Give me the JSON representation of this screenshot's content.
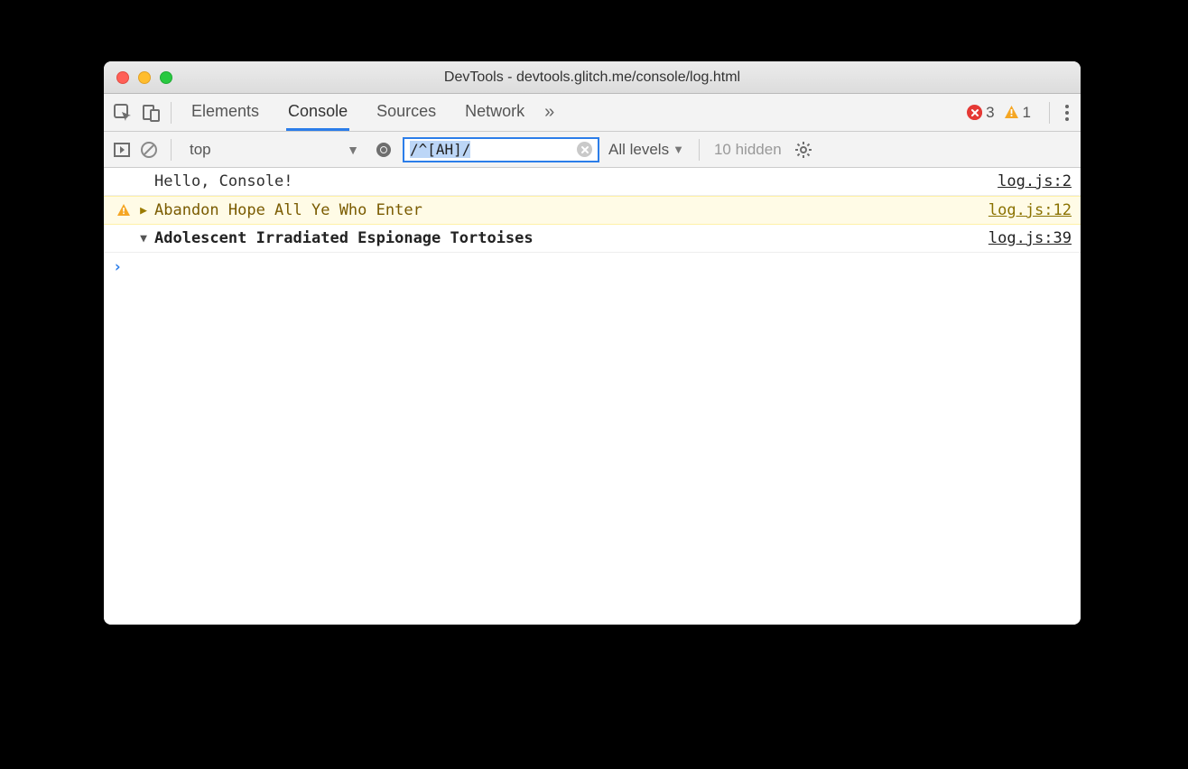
{
  "window": {
    "title": "DevTools - devtools.glitch.me/console/log.html"
  },
  "tabs": {
    "items": [
      "Elements",
      "Console",
      "Sources",
      "Network"
    ],
    "active_index": 1,
    "more_glyph": "»"
  },
  "status": {
    "error_count": "3",
    "warning_count": "1"
  },
  "toolbar": {
    "context": "top",
    "filter_value": "/^[AH]/",
    "levels_label": "All levels",
    "hidden_label": "10 hidden"
  },
  "logs": [
    {
      "type": "log",
      "disclosure": "",
      "message": "Hello, Console!",
      "source": "log.js:2"
    },
    {
      "type": "warn",
      "disclosure": "right",
      "message": "Abandon Hope All Ye Who Enter",
      "source": "log.js:12"
    },
    {
      "type": "info",
      "disclosure": "down",
      "message": "Adolescent Irradiated Espionage Tortoises",
      "source": "log.js:39"
    }
  ]
}
